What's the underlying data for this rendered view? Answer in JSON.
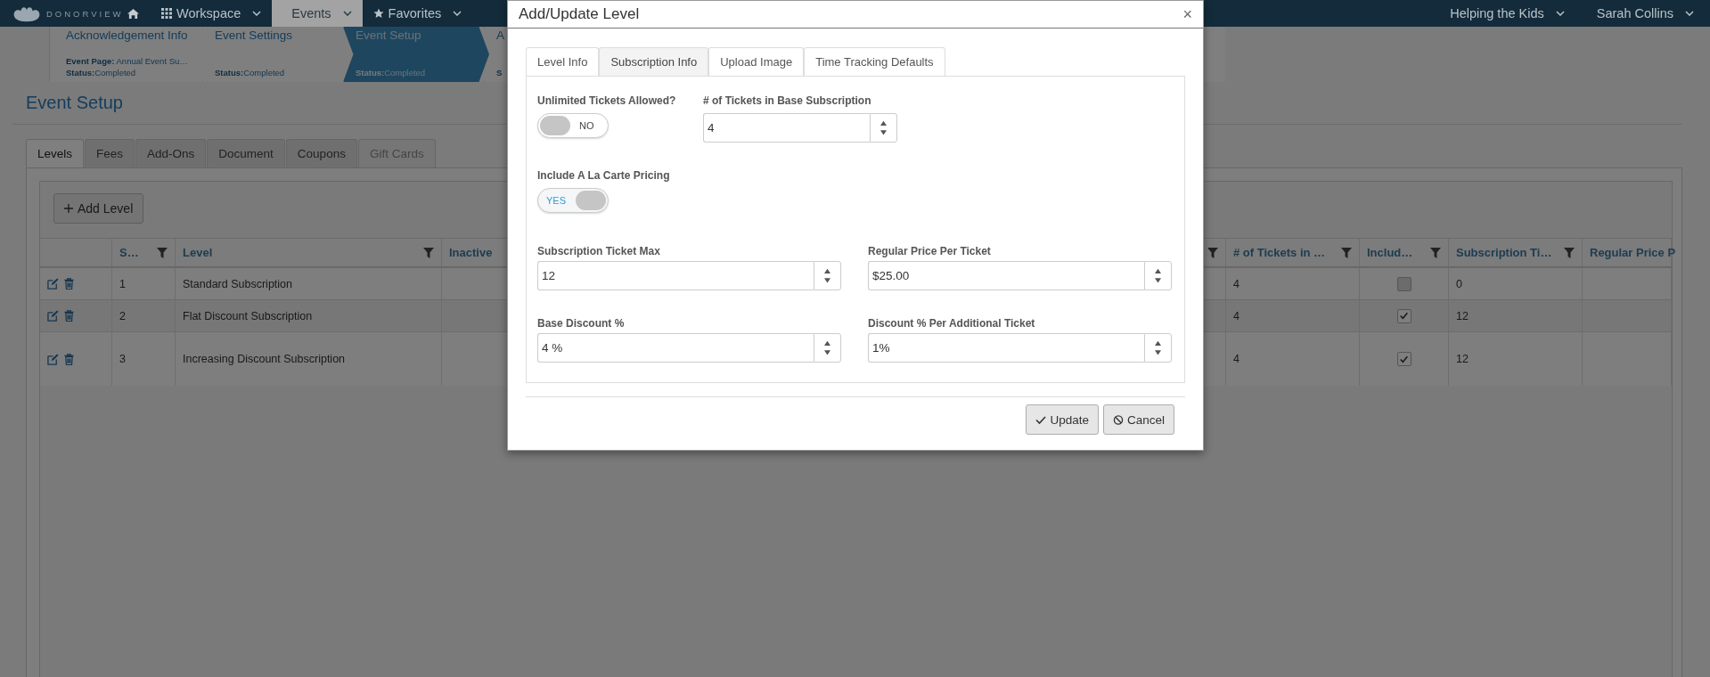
{
  "nav": {
    "logo": "DONORVIEW",
    "items": [
      {
        "label": "Workspace",
        "selected": false
      },
      {
        "label": "Events",
        "selected": true
      },
      {
        "label": "Favorites",
        "selected": false
      }
    ],
    "right": [
      "Helping the Kids",
      "Sarah Collins"
    ]
  },
  "steps": [
    {
      "title": "Acknowledgement Info",
      "page_label": "Event Page:",
      "page": "Annual Event Su…",
      "status_label": "Status:",
      "status": "Completed",
      "selected": false
    },
    {
      "title": "Event Settings",
      "status_label": "Status:",
      "status": "Completed",
      "selected": false
    },
    {
      "title": "Event Setup",
      "status_label": "Status:",
      "status": "Completed",
      "selected": true
    },
    {
      "title": "A",
      "status_label": "S",
      "selected": false
    }
  ],
  "heading": "Event Setup",
  "tabs": [
    {
      "label": "Levels",
      "selected": true,
      "disabled": false
    },
    {
      "label": "Fees",
      "selected": false,
      "disabled": false
    },
    {
      "label": "Add-Ons",
      "selected": false,
      "disabled": false
    },
    {
      "label": "Document",
      "selected": false,
      "disabled": false
    },
    {
      "label": "Coupons",
      "selected": false,
      "disabled": false
    },
    {
      "label": "Gift Cards",
      "selected": false,
      "disabled": true
    }
  ],
  "add_button": "Add Level",
  "table": {
    "columns": [
      {
        "label": "S…",
        "filter": true
      },
      {
        "label": "Level",
        "filter": true
      },
      {
        "label": "Inactive",
        "filter": false
      },
      {
        "filter": true
      },
      {
        "label": "# of Tickets in …",
        "filter": true
      },
      {
        "label": "Includ…",
        "filter": true
      },
      {
        "label": "Subscription Ti…",
        "filter": true
      },
      {
        "label": "Regular Price P",
        "filter": false
      }
    ],
    "rows": [
      {
        "seq": "1",
        "level": "Standard Subscription",
        "tickets": "4",
        "include": false,
        "sub_max": "0"
      },
      {
        "seq": "2",
        "level": "Flat Discount Subscription",
        "tickets": "4",
        "include": true,
        "sub_max": "12"
      },
      {
        "seq": "3",
        "level": "Increasing Discount Subscription",
        "tickets": "4",
        "include": true,
        "sub_max": "12"
      }
    ]
  },
  "modal": {
    "title": "Add/Update Level",
    "close": "×",
    "tabs": [
      {
        "label": "Level Info",
        "selected": false
      },
      {
        "label": "Subscription Info",
        "selected": true
      },
      {
        "label": "Upload Image",
        "selected": false
      },
      {
        "label": "Time Tracking Defaults",
        "selected": false
      }
    ],
    "toggles": [
      {
        "label": "Unlimited Tickets Allowed?",
        "on": false,
        "text": "NO"
      },
      {
        "label": "Include A La Carte Pricing",
        "on": true,
        "text": "YES"
      }
    ],
    "tickets_field": {
      "label": "# of Tickets in Base Subscription",
      "value": "4"
    },
    "fields": [
      {
        "label": "Subscription Ticket Max",
        "value": "12"
      },
      {
        "label": "Regular Price Per Ticket",
        "value": "$25.00"
      },
      {
        "label": "Base Discount %",
        "value": "4 %"
      },
      {
        "label": "Discount % Per Additional Ticket",
        "value": "1%"
      }
    ],
    "buttons": [
      {
        "label": "Update"
      },
      {
        "label": "Cancel"
      }
    ]
  }
}
